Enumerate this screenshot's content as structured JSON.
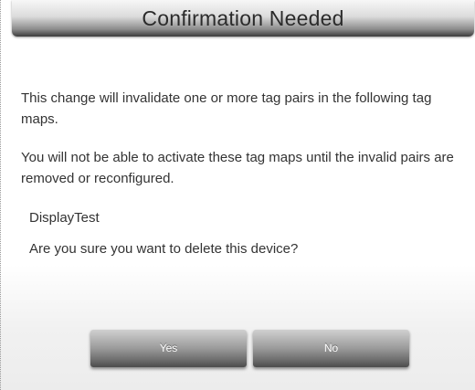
{
  "dialog": {
    "title": "Confirmation Needed",
    "message_line1": " This change will invalidate one or more tag pairs in the following tag maps.",
    "message_line2": " You will not be able to activate these tag maps until the invalid pairs are removed or reconfigured.",
    "tag_map_name": "DisplayTest",
    "question": "Are you sure you want to delete this device?",
    "yes_label": "Yes",
    "no_label": "No"
  }
}
